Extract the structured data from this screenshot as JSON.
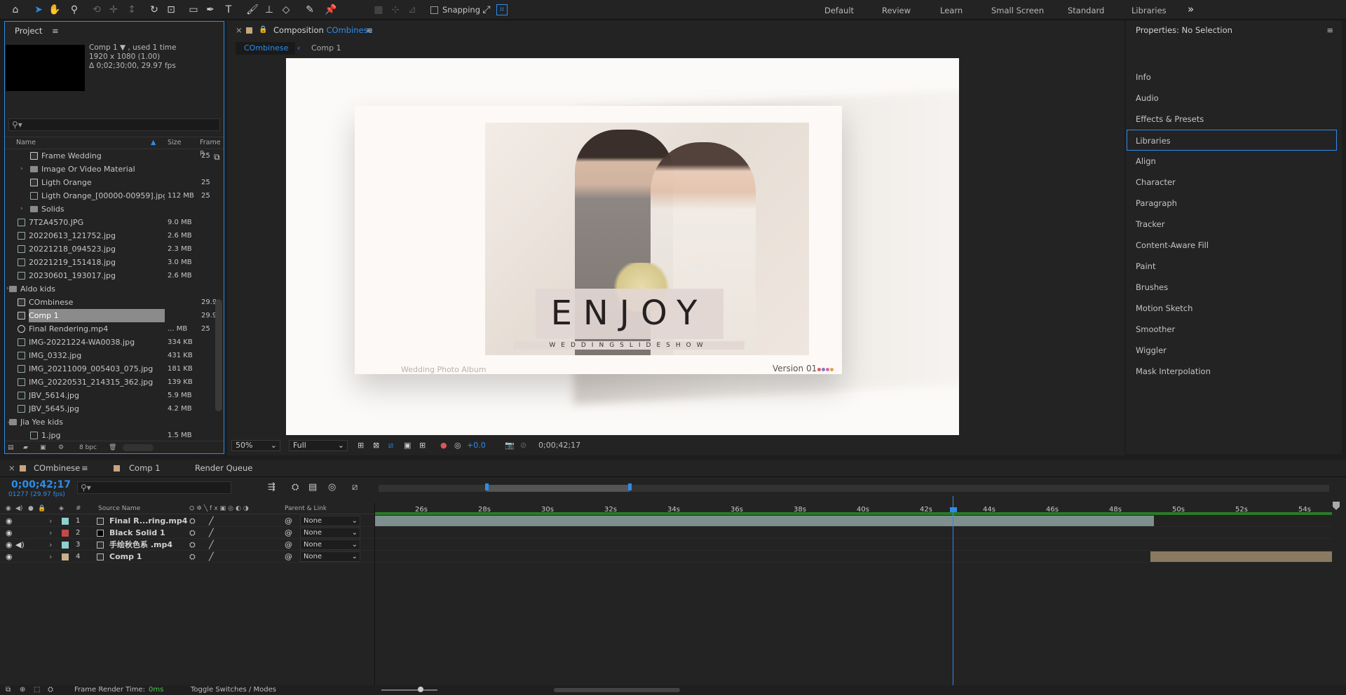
{
  "toolbar": {
    "snapping_label": "Snapping",
    "workspaces": [
      "Default",
      "Review",
      "Learn",
      "Small Screen",
      "Standard",
      "Libraries"
    ],
    "more_glyph": "»"
  },
  "project": {
    "title": "Project",
    "info": {
      "name": "Comp 1 ▼ , used 1 time",
      "size": "1920 x 1080 (1.00)",
      "duration": "Δ 0;02;30;00, 29.97 fps"
    },
    "search_glyph": "⚲▾",
    "columns": {
      "name": "Name",
      "size": "Size",
      "frame_rate": "Frame R"
    },
    "rows": [
      {
        "name": "Frame Wedding",
        "size": "",
        "fr": "25",
        "kind": "comp",
        "indent": 2
      },
      {
        "name": "Image Or Video Material",
        "size": "",
        "fr": "",
        "kind": "folder",
        "indent": 2,
        "tri": "›"
      },
      {
        "name": "Ligth Orange",
        "size": "",
        "fr": "25",
        "kind": "comp",
        "indent": 2
      },
      {
        "name": "Ligth Orange_[00000-00959].jpg",
        "size": "112 MB",
        "fr": "25",
        "kind": "file",
        "indent": 2
      },
      {
        "name": "Solids",
        "size": "",
        "fr": "",
        "kind": "folder",
        "indent": 2,
        "tri": "›"
      },
      {
        "name": "7T2A4570.JPG",
        "size": "9.0 MB",
        "fr": "",
        "kind": "file",
        "indent": 1
      },
      {
        "name": "20220613_121752.jpg",
        "size": "2.6 MB",
        "fr": "",
        "kind": "file",
        "indent": 1
      },
      {
        "name": "20221218_094523.jpg",
        "size": "2.3 MB",
        "fr": "",
        "kind": "file",
        "indent": 1
      },
      {
        "name": "20221219_151418.jpg",
        "size": "3.0 MB",
        "fr": "",
        "kind": "file",
        "indent": 1
      },
      {
        "name": "20230601_193017.jpg",
        "size": "2.6 MB",
        "fr": "",
        "kind": "file",
        "indent": 1
      },
      {
        "name": "Aldo kids",
        "size": "",
        "fr": "",
        "kind": "folder",
        "indent": 0,
        "tri": "›"
      },
      {
        "name": "COmbinese",
        "size": "",
        "fr": "29.9",
        "kind": "comp",
        "indent": 1
      },
      {
        "name": "Comp 1",
        "size": "",
        "fr": "29.9",
        "kind": "comp",
        "indent": 1,
        "selected": true
      },
      {
        "name": "Final Rendering.mp4",
        "size": "... MB",
        "fr": "25",
        "kind": "vid",
        "indent": 1
      },
      {
        "name": "IMG-20221224-WA0038.jpg",
        "size": "334 KB",
        "fr": "",
        "kind": "file",
        "indent": 1
      },
      {
        "name": "IMG_0332.jpg",
        "size": "431 KB",
        "fr": "",
        "kind": "file",
        "indent": 1
      },
      {
        "name": "IMG_20211009_005403_075.jpg",
        "size": "181 KB",
        "fr": "",
        "kind": "file",
        "indent": 1
      },
      {
        "name": "IMG_20220531_214315_362.jpg",
        "size": "139 KB",
        "fr": "",
        "kind": "file",
        "indent": 1
      },
      {
        "name": "JBV_5614.jpg",
        "size": "5.9 MB",
        "fr": "",
        "kind": "file",
        "indent": 1
      },
      {
        "name": "JBV_5645.jpg",
        "size": "4.2 MB",
        "fr": "",
        "kind": "file",
        "indent": 1
      },
      {
        "name": "Jia Yee kids",
        "size": "",
        "fr": "",
        "kind": "folder",
        "indent": 0,
        "tri": "⌄"
      },
      {
        "name": "1.jpg",
        "size": "1.5 MB",
        "fr": "",
        "kind": "file",
        "indent": 2
      }
    ],
    "bpc": "8 bpc"
  },
  "composition": {
    "tab_prefix": "Composition",
    "tab_name": "COmbinese",
    "crumbs": [
      "COmbinese",
      "Comp 1"
    ],
    "preview": {
      "title": "ENJOY",
      "subtitle": "WEDDINGSLIDESHOW",
      "caption_left": "Wedding Photo Album",
      "caption_right": "Version 01"
    },
    "zoom": "50%",
    "resolution": "Full",
    "exposure": "+0.0",
    "timecode": "0;00;42;17"
  },
  "properties": {
    "title": "Properties: No Selection",
    "items": [
      "Info",
      "Audio",
      "Effects & Presets",
      "Libraries",
      "Align",
      "Character",
      "Paragraph",
      "Tracker",
      "Content-Aware Fill",
      "Paint",
      "Brushes",
      "Motion Sketch",
      "Smoother",
      "Wiggler",
      "Mask Interpolation"
    ],
    "selected": "Libraries"
  },
  "timeline": {
    "tabs": [
      "COmbinese",
      "Comp 1",
      "Render Queue"
    ],
    "timecode": "0;00;42;17",
    "frames": "01277 (29.97 fps)",
    "search_glyph": "⚲▾",
    "header": {
      "num": "#",
      "source": "Source Name",
      "parent": "Parent & Link"
    },
    "layers": [
      {
        "num": "1",
        "name": "Final R...ring.mp4",
        "color": "#8fd0d0",
        "kind": "vid",
        "parent": "None"
      },
      {
        "num": "2",
        "name": "Black Solid 1",
        "color": "#c44a4a",
        "kind": "solid",
        "parent": "None"
      },
      {
        "num": "3",
        "name": "手绘秋色系 .mp4",
        "color": "#8fd0d0",
        "kind": "vid",
        "parent": "None"
      },
      {
        "num": "4",
        "name": "Comp 1",
        "color": "#c8b08a",
        "kind": "comp",
        "parent": "None"
      }
    ],
    "ticks": [
      "26s",
      "28s",
      "30s",
      "32s",
      "34s",
      "36s",
      "38s",
      "40s",
      "42s",
      "44s",
      "46s",
      "48s",
      "50s",
      "52s",
      "54s"
    ],
    "footer": {
      "render_label": "Frame Render Time:",
      "render_value": "0ms",
      "toggle": "Toggle Switches / Modes"
    }
  }
}
